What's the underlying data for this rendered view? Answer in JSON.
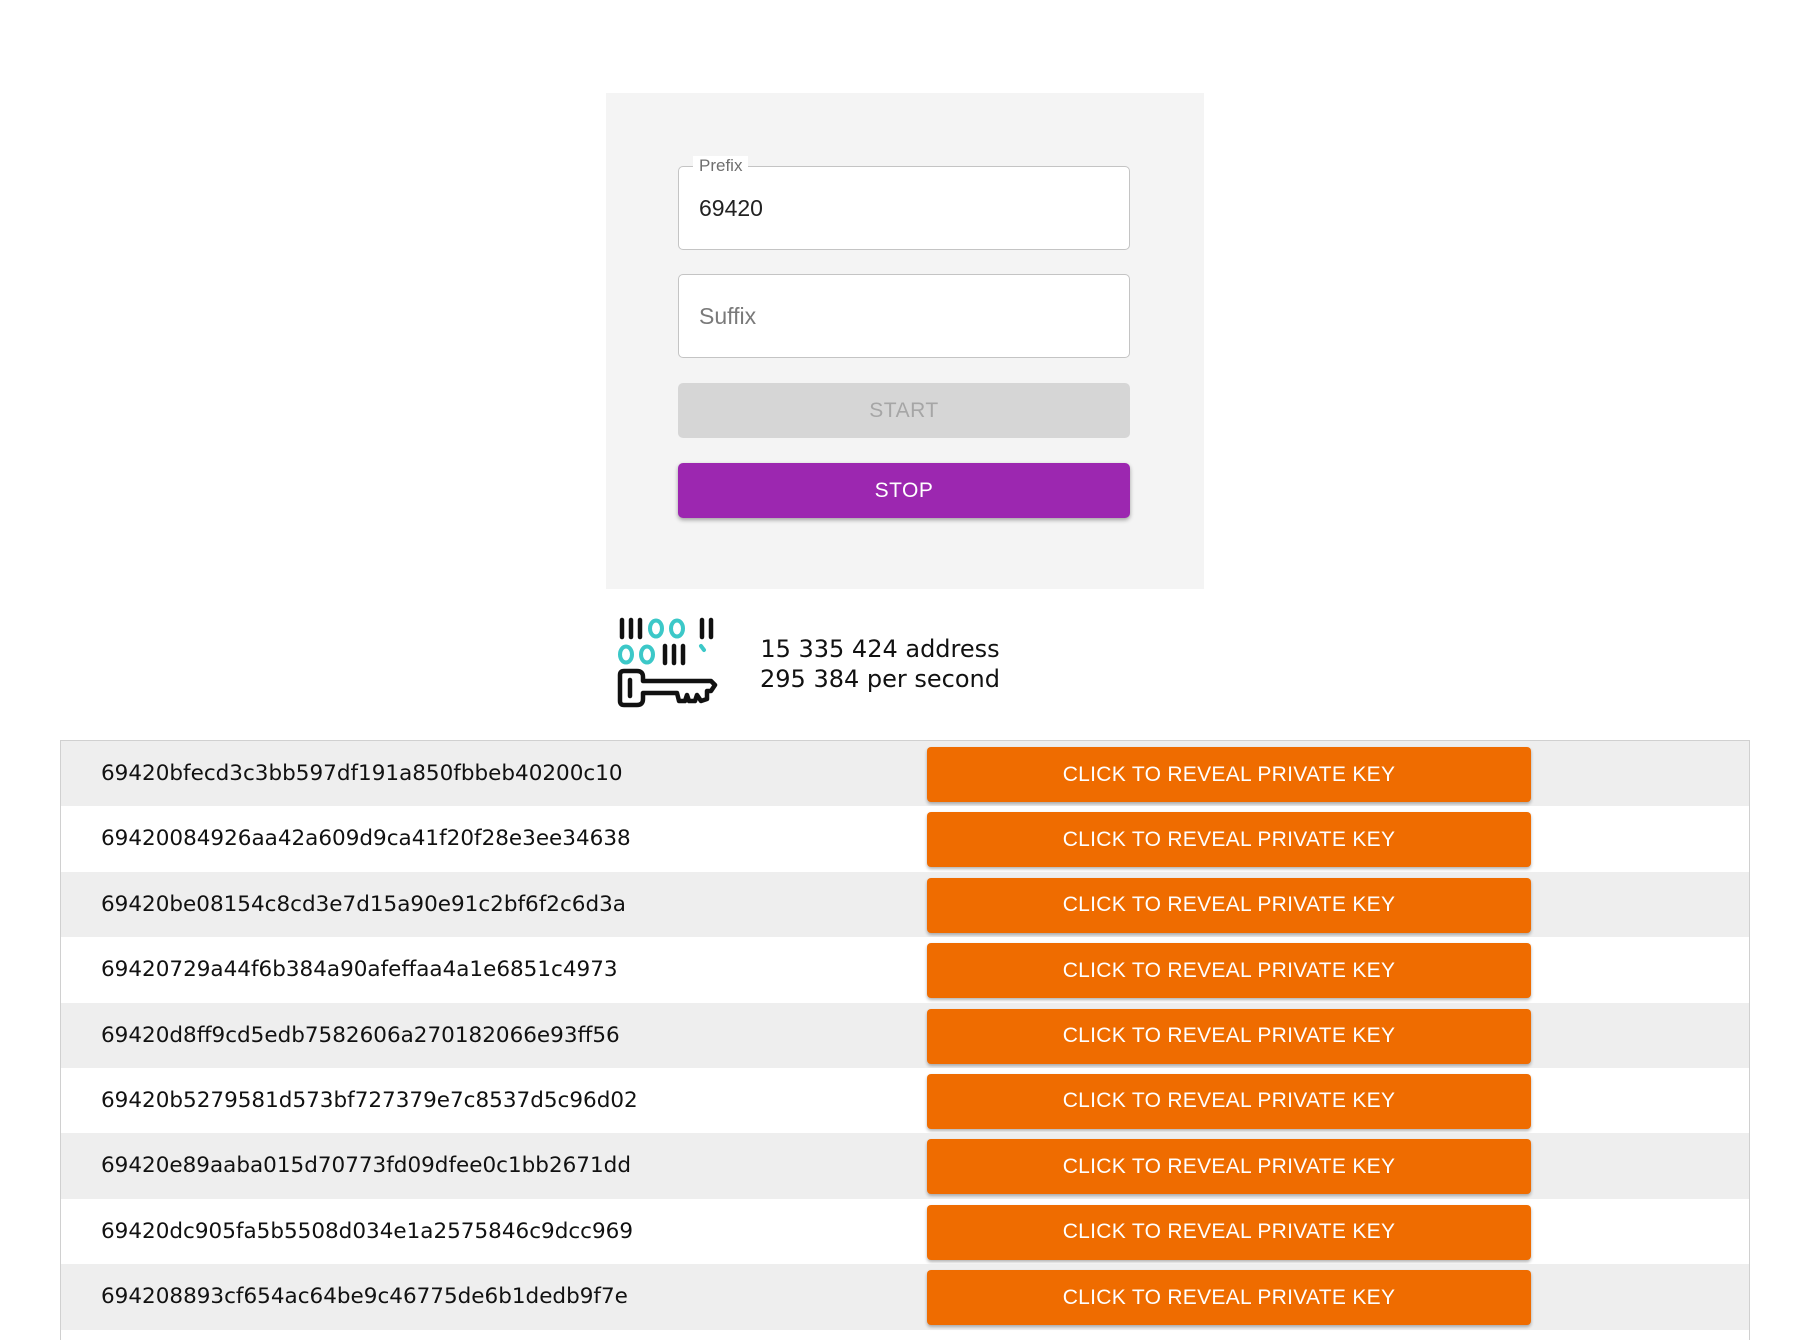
{
  "form": {
    "prefix_label": "Prefix",
    "prefix_value": "69420",
    "suffix_placeholder": "Suffix",
    "suffix_value": "",
    "start_label": "START",
    "stop_label": "STOP"
  },
  "stats": {
    "address_count": "15 335 424 address",
    "rate": "295 384 per second"
  },
  "results": {
    "button_label": "CLICK TO REVEAL PRIVATE KEY",
    "rows": [
      "69420bfecd3c3bb597df191a850fbbeb40200c10",
      "69420084926aa42a609d9ca41f20f28e3ee34638",
      "69420be08154c8cd3e7d15a90e91c2bf6f2c6d3a",
      "69420729a44f6b384a90afeffaa4a1e6851c4973",
      "69420d8ff9cd5edb7582606a270182066e93ff56",
      "69420b5279581d573bf727379e7c8537d5c96d02",
      "69420e89aaba015d70773fd09dfee0c1bb2671dd",
      "69420dc905fa5b5508d034e1a2575846c9dcc969",
      "694208893cf654ac64be9c46775de6b1dedb9f7e"
    ]
  },
  "colors": {
    "stop_button": "#9c27b0",
    "reveal_button": "#ef6c00",
    "icon_accent": "#3cc8c8"
  },
  "icons": {
    "logo": "binary-key-icon"
  }
}
